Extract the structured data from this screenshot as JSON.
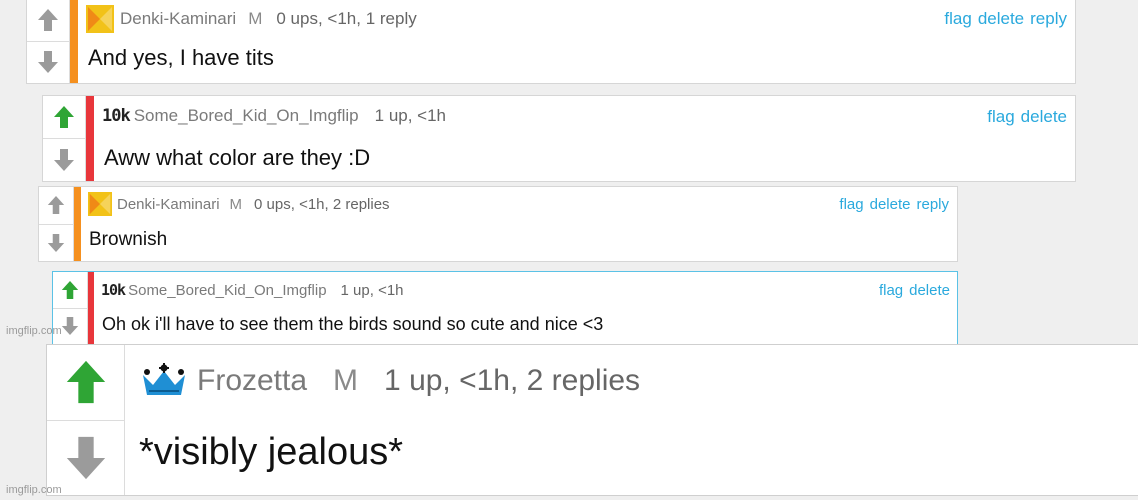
{
  "comments": [
    {
      "username": "Denki-Kaminari",
      "badge": "M",
      "meta": "0 ups, <1h, 1 reply",
      "text": "And yes, I have tits",
      "actions": [
        "flag",
        "delete",
        "reply"
      ],
      "stripe_color": "#f5901f",
      "upvoted": false
    },
    {
      "rank": "10k",
      "username": "Some_Bored_Kid_On_Imgflip",
      "meta": "1 up, <1h",
      "text": "Aww what color are they :D",
      "actions": [
        "flag",
        "delete"
      ],
      "stripe_color": "#e8363b",
      "upvoted": true
    },
    {
      "username": "Denki-Kaminari",
      "badge": "M",
      "meta": "0 ups, <1h, 2 replies",
      "text": "Brownish",
      "actions": [
        "flag",
        "delete",
        "reply"
      ],
      "stripe_color": "#f5901f",
      "upvoted": false
    },
    {
      "rank": "10k",
      "username": "Some_Bored_Kid_On_Imgflip",
      "meta": "1 up, <1h",
      "text": "Oh ok i'll have to see them the birds sound so cute and nice <3",
      "actions": [
        "flag",
        "delete"
      ],
      "stripe_color": "#e8363b",
      "upvoted": true
    },
    {
      "username": "Frozetta",
      "badge": "M",
      "meta": "1 up, <1h, 2 replies",
      "text": "*visibly jealous*",
      "actions": [],
      "stripe_color": "",
      "upvoted": true
    }
  ],
  "watermarks": [
    "imgflip.com",
    "imgflip.com"
  ],
  "colors": {
    "link": "#2aa9dd",
    "upvote": "#2fa535",
    "arrow_gray": "#9b9b9b",
    "crown": "#1f8fd4"
  },
  "icons": {
    "up": "arrow-up-icon",
    "down": "arrow-down-icon",
    "crown": "crown-icon"
  }
}
